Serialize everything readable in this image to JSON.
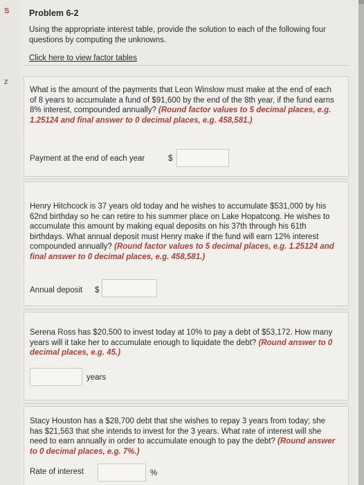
{
  "sidebar": {
    "mark_top": "S",
    "mark_mid": "z"
  },
  "header": {
    "title": "Problem 6-2",
    "instructions": "Using the appropriate interest table, provide the solution to each of the following four questions by computing the unknowns.",
    "link": "Click here to view factor tables"
  },
  "q1": {
    "text": "What is the amount of the payments that Leon Winslow must make at the end of each of 8 years to accumulate a fund of $91,600 by the end of the 8th year, if the fund earns 8% interest, compounded annually?",
    "hint": "(Round factor values to 5 decimal places, e.g. 1.25124 and final answer to 0 decimal places, e.g. 458,581.)",
    "answer_label": "Payment at the end of each year",
    "currency": "$",
    "value": ""
  },
  "q2": {
    "text": "Henry Hitchcock is 37 years old today and he wishes to accumulate $531,000 by his 62nd birthday so he can retire to his summer place on Lake Hopatcong. He wishes to accumulate this amount by making equal deposits on his 37th through his 61th birthdays. What annual deposit must Henry make if the fund will earn 12% interest compounded annually?",
    "hint": "(Round factor values to 5 decimal places, e.g. 1.25124 and final answer to 0 decimal places, e.g. 458,581.)",
    "answer_label": "Annual deposit",
    "currency": "$",
    "value": ""
  },
  "q3": {
    "text": "Serena Ross has $20,500 to invest today at 10% to pay a debt of $53,172. How many years will it take her to accumulate enough to liquidate the debt?",
    "hint": "(Round answer to 0 decimal places, e.g. 45.)",
    "unit": "years",
    "value": ""
  },
  "q4": {
    "text": "Stacy Houston has a $28,700 debt that she wishes to repay 3 years from today; she has $21,563 that she intends to invest for the 3 years. What rate of interest will she need to earn annually in order to accumulate enough to pay the debt?",
    "hint": "(Round answer to 0 decimal places, e.g. 7%.)",
    "answer_label": "Rate of interest",
    "unit": "%",
    "value": ""
  }
}
